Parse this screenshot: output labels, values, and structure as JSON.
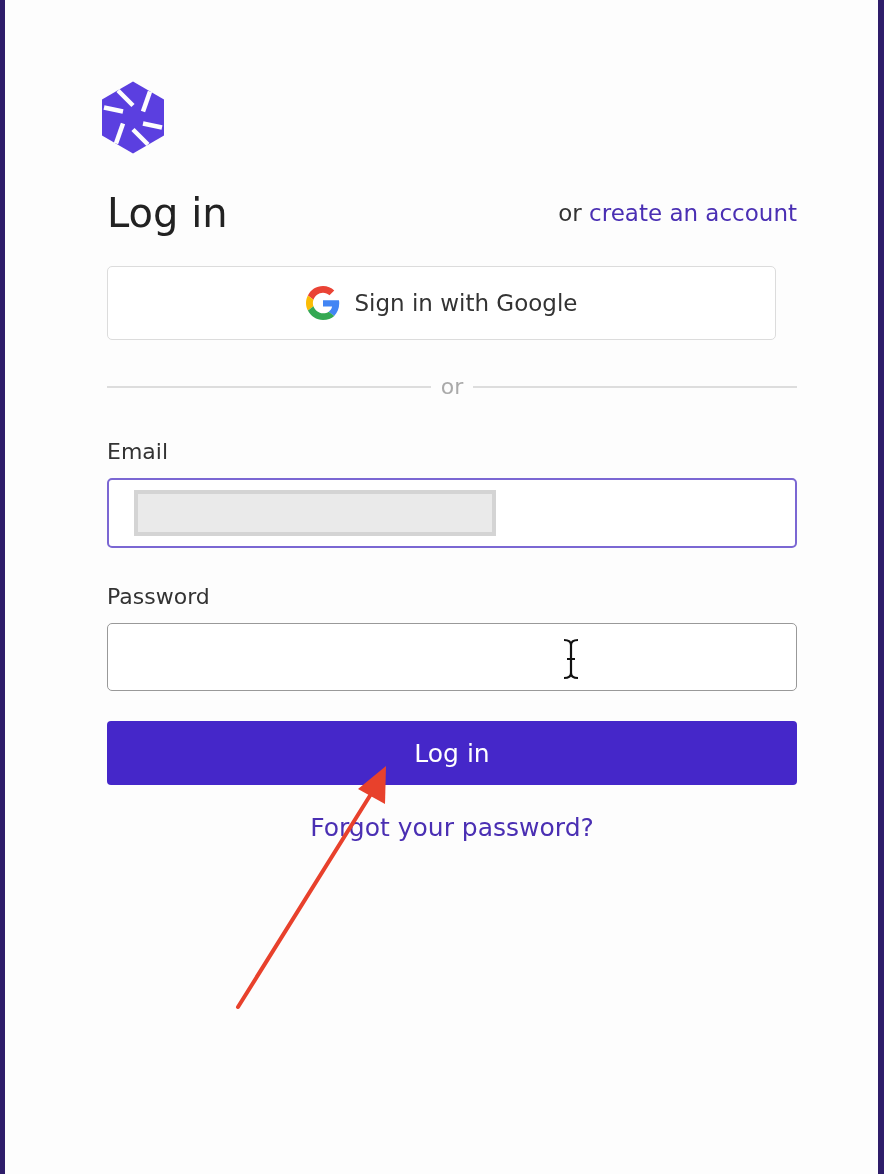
{
  "heading": "Log in",
  "signup": {
    "prefix": "or",
    "link": "create an account"
  },
  "google_button": "Sign in with Google",
  "divider": "or",
  "fields": [
    {
      "label": "Email",
      "focused": true,
      "redacted": true
    },
    {
      "label": "Password",
      "focused": false,
      "redacted": false
    }
  ],
  "submit_button": "Log in",
  "forgot_link": "Forgot your password?",
  "mouse_cursor": {
    "kind": "text"
  },
  "annotations": [
    {
      "kind": "arrow"
    }
  ]
}
